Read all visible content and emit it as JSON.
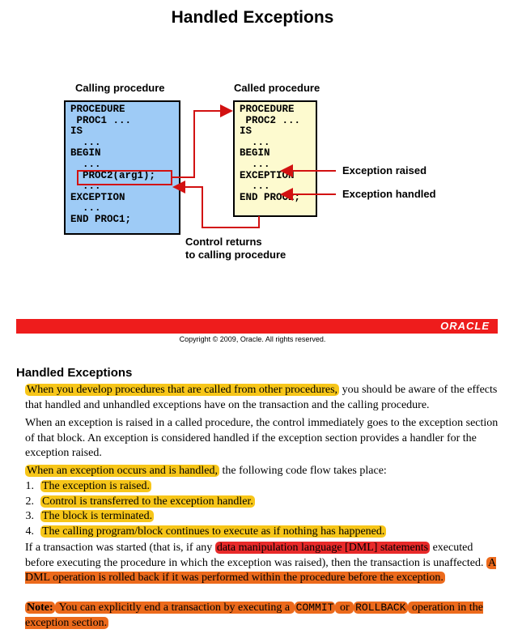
{
  "slide": {
    "title": "Handled Exceptions",
    "calling_caption": "Calling procedure",
    "called_caption": "Called procedure",
    "calling_code": "PROCEDURE\n PROC1 ...\nIS\n  ...\nBEGIN\n  ...\n  PROC2(arg1);\n  ...\nEXCEPTION\n  ...\nEND PROC1;",
    "called_code": "PROCEDURE\n PROC2 ...\nIS\n  ...\nBEGIN\n  ...\nEXCEPTION\n  ...\nEND PROC2;",
    "exception_raised": "Exception raised",
    "exception_handled": "Exception handled",
    "control_returns_1": "Control returns",
    "control_returns_2": "to calling procedure",
    "brand": "ORACLE",
    "copyright": "Copyright © 2009, Oracle. All rights reserved."
  },
  "notes": {
    "heading": "Handled Exceptions",
    "p1_hl": "When you develop procedures that are called from other procedures,",
    "p1_rest": " you should be aware of the effects that handled and unhandled exceptions have on the transaction and the calling procedure.",
    "p2": "When an exception is raised in a called procedure, the control immediately goes to the exception section of that block. An exception is considered handled if the exception section provides a handler for the exception raised.",
    "p3_hl": "When an exception occurs and is handled,",
    "p3_rest": " the following code flow takes place:",
    "steps": [
      {
        "num": "1.",
        "text": "The exception is raised."
      },
      {
        "num": "2.",
        "text": "Control is transferred to the exception handler."
      },
      {
        "num": "3.",
        "text": "The block is terminated."
      },
      {
        "num": "4.",
        "text": "The calling program/block continues to execute as if nothing has happened."
      }
    ],
    "p4_a": "If a transaction was started (that is, if any ",
    "p4_hl": "data manipulation language [DML] statements",
    "p4_b": " executed before executing the procedure in which the exception was raised), then the transaction is unaffected. ",
    "p4_hl2": "A DML operation is rolled back if it was performed within the procedure before the exception.",
    "note_label": "Note:",
    "note_a": " You can explicitly end a transaction by executing a ",
    "note_commit": "COMMIT",
    "note_or": " or ",
    "note_rollback": "ROLLBACK",
    "note_b": " operation in the exception section."
  },
  "colors": {
    "yellow_highlight": "#f7c619",
    "orange_highlight": "#ec6a1c",
    "red_highlight": "#e82a2a",
    "arrow_red": "#d21111",
    "calling_box": "#9ecbf6",
    "called_box": "#fdfacf"
  }
}
